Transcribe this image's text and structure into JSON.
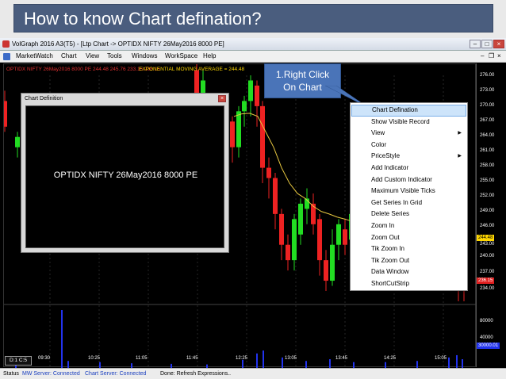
{
  "slide": {
    "title": "How to know Chart defination?"
  },
  "window": {
    "title": "VolGraph 2016 A3(T5) - [Ltp Chart -> OPTIDX  NIFTY  26May2016  8000  PE]"
  },
  "menu": {
    "items": [
      "MarketWatch",
      "Chart",
      "View",
      "Tools",
      "Windows",
      "WorkSpace",
      "Help"
    ],
    "mdi_minimize": "–",
    "mdi_restore": "❐",
    "mdi_close": "×"
  },
  "chart": {
    "info_line": "OPTIDX  NIFTY  26May2016  8000  PE  244.48  245.76  233.15  236.15",
    "ema_label": "EXPONENTIAL MOVING AVERAGE = 244.48",
    "price_ticks": [
      "276.00",
      "273.00",
      "270.00",
      "267.00",
      "264.00",
      "261.00",
      "258.00",
      "255.00",
      "252.00",
      "249.00",
      "246.00",
      "243.00",
      "240.00",
      "237.00",
      "234.00"
    ],
    "ema_tag": "244.48",
    "last_tag": "236.15",
    "volume_ticks": [
      "80000",
      "40000"
    ],
    "volume_tag": "30000.01",
    "time_ticks": [
      "09:30",
      "10:25",
      "11:05",
      "11:45",
      "12:25",
      "13:05",
      "13:45",
      "14:25",
      "15:05"
    ],
    "corner_badge": "D:1 C:5",
    "colors": {
      "up": "#22dd22",
      "down": "#ee2222",
      "ema": "#e8c840",
      "volume": "#2233ee"
    }
  },
  "chart_definition_window": {
    "title": "Chart Definition",
    "content": "OPTIDX  NIFTY  26May2016  8000  PE"
  },
  "callout": {
    "line1": "1.Right Click",
    "line2": "On Chart"
  },
  "context_menu": {
    "items": [
      {
        "label": "Chart Defination",
        "highlighted": true
      },
      {
        "label": "Show Visible Record"
      },
      {
        "label": "View",
        "submenu": true
      },
      {
        "label": "Color"
      },
      {
        "label": "PriceStyle",
        "submenu": true
      },
      {
        "label": "Add Indicator"
      },
      {
        "label": "Add Custom Indicator"
      },
      {
        "label": "Maximum Visible Ticks"
      },
      {
        "label": "Get Series In Grid"
      },
      {
        "label": "Delete Series"
      },
      {
        "label": "Zoom In"
      },
      {
        "label": "Zoom Out"
      },
      {
        "label": "Tik Zoom In"
      },
      {
        "label": "Tik Zoom Out"
      },
      {
        "label": "Data Window"
      },
      {
        "label": "ShortCutStrip"
      }
    ]
  },
  "status": {
    "label": "Status",
    "mw_server": "MW Server: Connected",
    "chart_server": "Chart Server: Connected",
    "message": "Done: Refresh Expressions.."
  }
}
